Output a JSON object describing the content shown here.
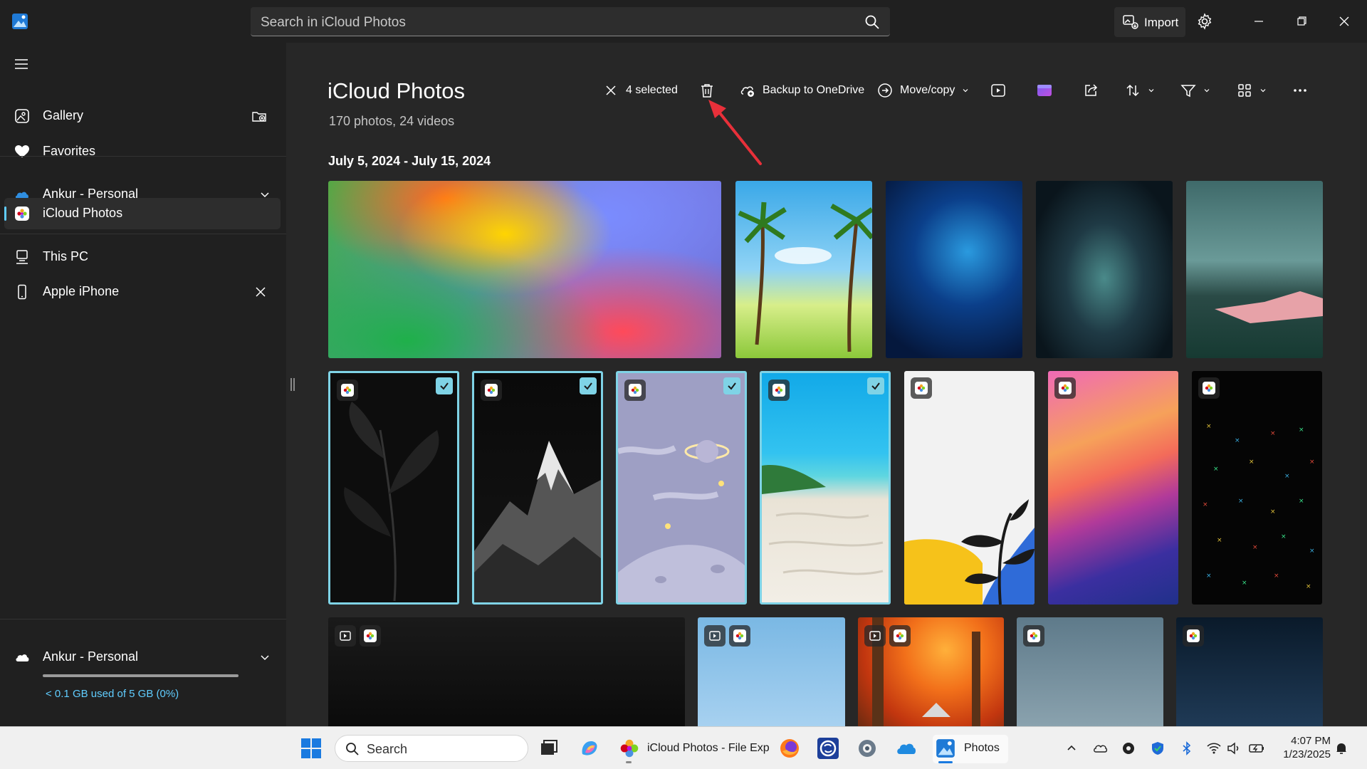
{
  "window": {
    "search_placeholder": "Search in iCloud Photos",
    "import_label": "Import"
  },
  "sidebar": {
    "items": [
      {
        "label": "Gallery",
        "icon": "gallery-icon"
      },
      {
        "label": "Favorites",
        "icon": "heart-icon"
      },
      {
        "label": "Ankur - Personal",
        "icon": "onedrive-icon"
      },
      {
        "label": "iCloud Photos",
        "icon": "icloud-photos-icon",
        "active": true
      },
      {
        "label": "This PC",
        "icon": "pc-icon"
      },
      {
        "label": "Apple iPhone",
        "icon": "phone-icon"
      }
    ],
    "storage": {
      "account": "Ankur - Personal",
      "usage_text": "< 0.1 GB used of 5 GB (0%)"
    }
  },
  "main": {
    "title": "iCloud Photos",
    "subtitle": "170 photos, 24 videos",
    "date_range": "July 5, 2024 - July 15, 2024",
    "toolbar": {
      "selected_label": "4 selected",
      "backup_label": "Backup to OneDrive",
      "move_label": "Move/copy"
    }
  },
  "taskbar": {
    "search_label": "Search",
    "explorer_label": "iCloud Photos - File Exp",
    "photos_label": "Photos",
    "time": "4:07 PM",
    "date": "1/23/2025"
  },
  "colors": {
    "accent": "#60cdff",
    "selection": "#7fd3e6",
    "annotation_arrow": "#e8303a"
  }
}
